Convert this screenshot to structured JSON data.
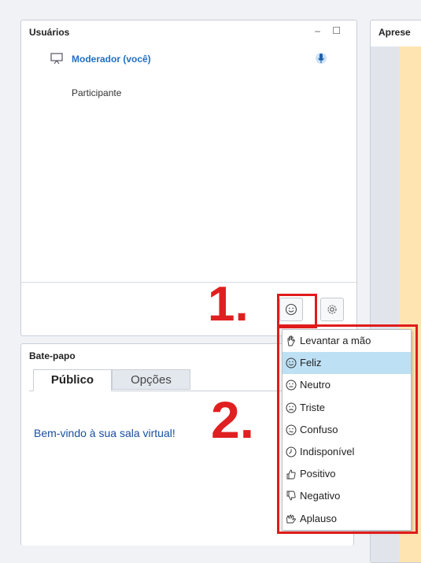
{
  "users_panel": {
    "title": "Usuários",
    "window_controls": "– ☐",
    "users": [
      {
        "name": "Moderador (você)",
        "role": "moderator"
      },
      {
        "name": "Participante",
        "role": "viewer"
      }
    ]
  },
  "presentation_panel": {
    "title": "Aprese"
  },
  "chat_panel": {
    "title": "Bate-papo",
    "tabs": [
      {
        "label": "Público"
      },
      {
        "label": "Opções"
      }
    ],
    "welcome_message": "Bem-vindo à sua sala virtual!"
  },
  "annotations": {
    "step1": "1.",
    "step2": "2."
  },
  "status_menu": {
    "items": [
      {
        "label": "Levantar a mão",
        "icon": "raise-hand-icon"
      },
      {
        "label": "Feliz",
        "icon": "happy-face-icon",
        "selected": true
      },
      {
        "label": "Neutro",
        "icon": "neutral-face-icon"
      },
      {
        "label": "Triste",
        "icon": "sad-face-icon"
      },
      {
        "label": "Confuso",
        "icon": "confused-face-icon"
      },
      {
        "label": "Indisponível",
        "icon": "clock-icon"
      },
      {
        "label": "Positivo",
        "icon": "thumbs-up-icon"
      },
      {
        "label": "Negativo",
        "icon": "thumbs-down-icon"
      },
      {
        "label": "Aplauso",
        "icon": "applause-icon"
      }
    ]
  },
  "colors": {
    "accent": "#1f6fc5",
    "highlight": "#e01b1b",
    "selected_bg": "#bee0f4"
  }
}
